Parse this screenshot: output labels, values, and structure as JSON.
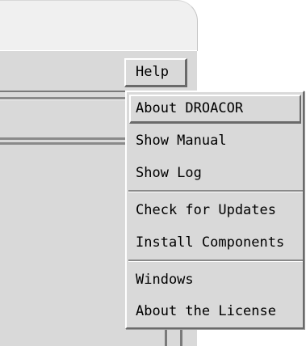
{
  "menubar": {
    "help_label": "Help"
  },
  "help_menu": {
    "items": [
      {
        "label": "About DROACOR"
      },
      {
        "label": "Show Manual"
      },
      {
        "label": "Show Log"
      },
      {
        "label": "Check for Updates"
      },
      {
        "label": "Install Components"
      },
      {
        "label": "Windows"
      },
      {
        "label": "About the License"
      }
    ],
    "highlighted_item": "About DROACOR"
  }
}
